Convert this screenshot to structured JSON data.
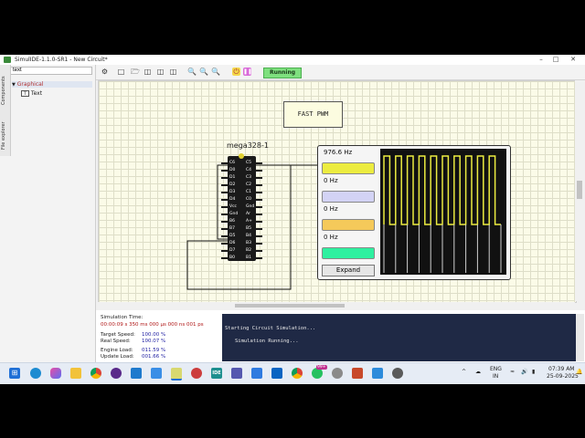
{
  "window": {
    "title": "SimulIDE-1.1.0-SR1 - New Circuit*",
    "minimize_icon": "minimize-icon",
    "maximize_icon": "maximize-icon",
    "close_icon": "close-icon"
  },
  "side_tabs": [
    "Components",
    "File explorer"
  ],
  "search": {
    "value": "text"
  },
  "tree": {
    "group": "Graphical",
    "item": "Text"
  },
  "toolbar": {
    "status": "Running"
  },
  "circuit": {
    "label_text": "FAST PWM",
    "chip_name": "mega328-1",
    "pins_left": [
      "C6",
      "D0",
      "D1",
      "D2",
      "D3",
      "D4",
      "Vcc",
      "Gnd",
      "B6",
      "B7",
      "D5",
      "D6",
      "D7",
      "B0"
    ],
    "pins_right": [
      "C5",
      "C4",
      "C3",
      "C2",
      "C1",
      "C0",
      "Gnd",
      "Ar",
      "A+",
      "B5",
      "B4",
      "B3",
      "B2",
      "B1"
    ],
    "freq_meter": {
      "channels": [
        {
          "freq": "976.6 Hz",
          "color": "#ecec40"
        },
        {
          "freq": "0 Hz",
          "color": "#d3d3f5"
        },
        {
          "freq": "0 Hz",
          "color": "#f5c95a"
        },
        {
          "freq": "0 Hz",
          "color": "#2ef0a0"
        }
      ],
      "expand_label": "Expand",
      "duty_fraction": 0.5,
      "pulse_count": 10
    }
  },
  "stats": {
    "sim_time_label": "Simulation Time:",
    "sim_time_value": "00:00:09 s  350 ms  000 µs  000 ns  001 ps",
    "target_speed_label": "Target Speed:",
    "target_speed_value": "100.00 %",
    "real_speed_label": "Real Speed:",
    "real_speed_value": "100.07 %",
    "engine_load_label": "Engine Load:",
    "engine_load_value": "011.59 %",
    "update_load_label": "Update Load:",
    "update_load_value": "001.66 %"
  },
  "console": {
    "lines": [
      "Starting Circuit Simulation...",
      "Simulation Running..."
    ]
  },
  "taskbar": {
    "lang": "ENG",
    "region": "IN",
    "time": "07:39 AM",
    "date": "25-09-2025",
    "ide_label": "IDE",
    "notif_badge": "99+"
  }
}
